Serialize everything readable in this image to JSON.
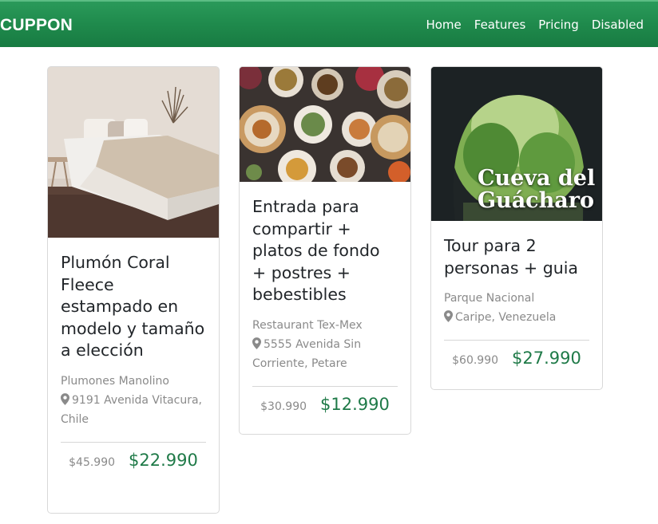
{
  "navbar": {
    "brand": "CUPPON",
    "links": [
      "Home",
      "Features",
      "Pricing",
      "Disabled"
    ]
  },
  "colors": {
    "navbar": "#1f8a4c",
    "price": "#1f7a48",
    "muted": "#8a8a8a"
  },
  "cards": [
    {
      "image": "bedroom-photo",
      "title": "Plumón Coral Fleece estampado en modelo y tamaño a elección",
      "merchant": "Plumones Manolino",
      "address": "9191 Avenida Vitacura, Chile",
      "old_price": "$45.990",
      "new_price": "$22.990"
    },
    {
      "image": "food-platters-photo",
      "title": "Entrada para compartir + platos de fondo + postres + bebestibles",
      "merchant": "Restaurant Tex-Mex",
      "address": "5555 Avenida Sin Corriente, Petare",
      "old_price": "$30.990",
      "new_price": "$12.990"
    },
    {
      "image": "cave-photo",
      "image_text": "Cueva del Guácharo",
      "title": "Tour para 2 personas + guia",
      "merchant": "Parque Nacional",
      "address": "Caripe, Venezuela",
      "old_price": "$60.990",
      "new_price": "$27.990"
    }
  ]
}
